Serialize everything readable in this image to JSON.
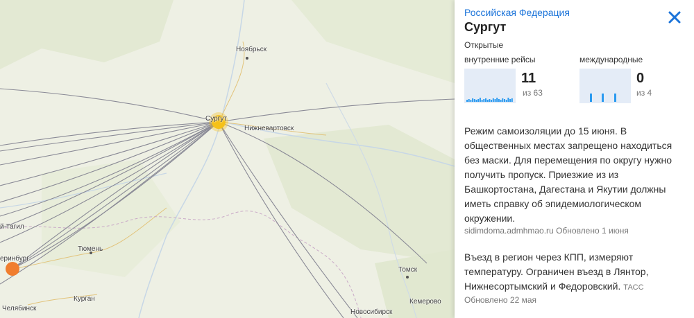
{
  "map": {
    "cities": [
      {
        "name": "Ноябрьск"
      },
      {
        "name": "Сургут"
      },
      {
        "name": "Нижневартовск"
      },
      {
        "name": "Тюмень"
      },
      {
        "name": "еринбург"
      },
      {
        "name": "й Тагил"
      },
      {
        "name": "Курган"
      },
      {
        "name": "Челябинск"
      },
      {
        "name": "Томск"
      },
      {
        "name": "Кемерово"
      },
      {
        "name": "Новосибирск"
      }
    ],
    "colors": {
      "hub": "#f5c118",
      "origin": "#f07d2e",
      "route": "#8a8a96"
    }
  },
  "panel": {
    "region": "Российская Федерация",
    "city": "Сургут",
    "close_icon": "close-icon",
    "open_label": "Открытые",
    "domestic": {
      "label": "внутренние рейсы",
      "count": "11",
      "total": "из 63"
    },
    "international": {
      "label": "международные",
      "count": "0",
      "total": "из 4"
    },
    "rules": "Режим самоизоляции до 15 июня. В общественных местах запрещено находиться без маски. Для перемещения по округу нужно получить пропуск. Приезжие из из Башкортостана, Дагестана и Якутии должны иметь справку об эпидемиологическом окружении.",
    "rules_source": "sidimdoma.admhmao.ru",
    "rules_updated": "Обновлено 1 июня",
    "entry": "Въезд в регион через КПП, измеряют температуру. Ограничен въезд в Лянтор, Нижнесортымский и Федоровский.",
    "entry_source": "ТАСС",
    "entry_updated": "Обновлено 22 мая",
    "accent_color": "#1a73d9"
  }
}
